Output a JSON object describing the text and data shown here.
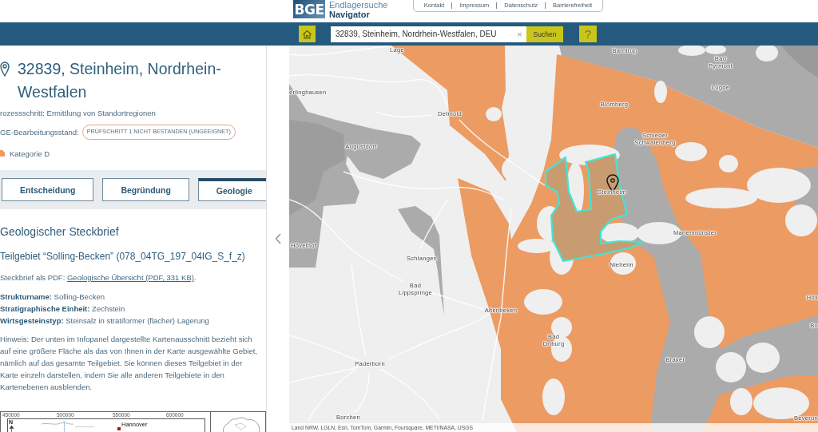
{
  "header": {
    "logo": "BGE",
    "brand": [
      "Endlagersuche",
      "Navigator"
    ],
    "links": [
      "Kontakt",
      "Impressum",
      "Datenschutz",
      "Barrierefreiheit"
    ]
  },
  "toolbar": {
    "search": {
      "value": "32839, Steinheim, Nordrhein-Westfalen, DEU",
      "clear": "×"
    },
    "search_button": "Suchen",
    "help_button": "?"
  },
  "panel": {
    "title": "32839, Steinheim, Nordrhein-Westfalen",
    "process_step": "rozessschritt: Ermittlung von Standortregionen",
    "status": {
      "label": "GE-Bearbeitungsstand:",
      "badge": "PRÜFSCHRITT 1 NICHT BESTANDEN (UNGEEIGNET)"
    },
    "category": "Kategorie D",
    "tabs": [
      {
        "label": "Entscheidung",
        "selected": false
      },
      {
        "label": "Begründung",
        "selected": false
      },
      {
        "label": "Geologie",
        "selected": true
      }
    ],
    "heading": "Geologischer Steckbrief",
    "subarea": "Teilgebiet “Solling-Becken” (078_04TG_197_04IG_S_f_z)",
    "pdf": {
      "prefix": "Steckbrief als PDF:",
      "link": "Geologische Übersicht (PDF, 331 KB)",
      "suffix": "."
    },
    "facts": [
      "**Strukturname:** Solling-Becken",
      "**Stratigraphische Einheit:** Zechstein",
      "**Wirtsgesteinstyp:** Steinsalz in stratiformer (flacher) Lagerung"
    ],
    "note": "Hinweis: Der unten im Infopanel dargestellte Kartenausschnitt bezieht sich auf eine größere Fläche als das von Ihnen in der Karte ausgewählte Gebiet, nämlich auf das gesamte Teilgebiet. Sie können dieses Teilgebiet in der Karte einzeln darstellen, indem Sie alle anderen Teilgebiete in den Kartenebenen ausblenden.",
    "inset_map": {
      "xticks": [
        "450000",
        "500000",
        "550000",
        "600000"
      ],
      "north": "N",
      "places": [
        "Hannover"
      ]
    }
  },
  "map": {
    "place_labels": [
      "Lage",
      "erlinghausen",
      "Detmold",
      "Augustdorf",
      "Hövelhof",
      "Schlangen",
      "Bad Lippspringe",
      "Altenbeken",
      "Bad Driburg",
      "Paderborn",
      "Borchen",
      "Barntrup",
      "Bad Pyrmont",
      "Lügde",
      "Blomberg",
      "Schieder Schwalenberg",
      "Steinheim",
      "Marienmünster",
      "Nieheim",
      "Brakel",
      "Höx",
      "Bo",
      "Beverun"
    ],
    "attribution": "Land NRW, LGLN, Esri, TomTom, Garmin, Foursquare, METI/NASA, USGS"
  }
}
